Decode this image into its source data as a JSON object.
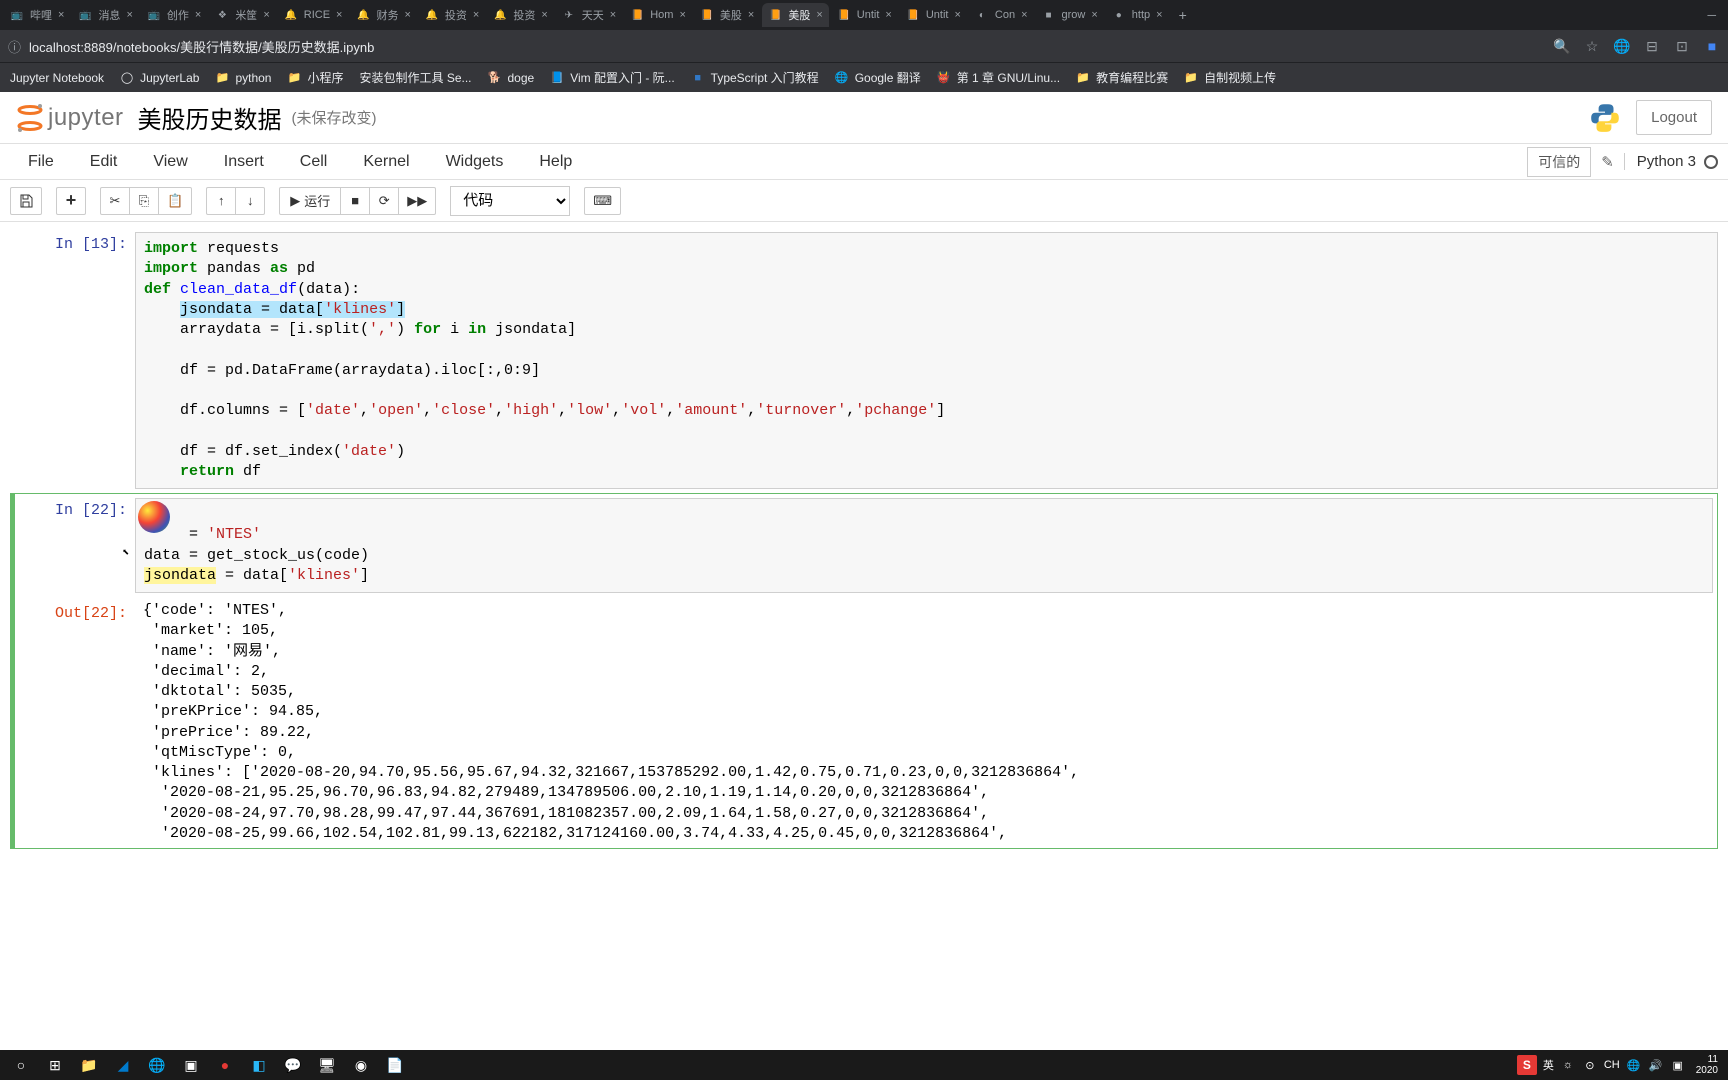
{
  "browser": {
    "tabs": [
      {
        "label": "哔哩",
        "active": false
      },
      {
        "label": "消息",
        "active": false
      },
      {
        "label": "创作",
        "active": false
      },
      {
        "label": "米筐",
        "active": false
      },
      {
        "label": "RICE",
        "active": false
      },
      {
        "label": "财务",
        "active": false
      },
      {
        "label": "投资",
        "active": false
      },
      {
        "label": "投资",
        "active": false
      },
      {
        "label": "天天",
        "active": false
      },
      {
        "label": "Hom",
        "active": false
      },
      {
        "label": "美股",
        "active": false
      },
      {
        "label": "美股",
        "active": true
      },
      {
        "label": "Untit",
        "active": false
      },
      {
        "label": "Untit",
        "active": false
      },
      {
        "label": "Con",
        "active": false
      },
      {
        "label": "grow",
        "active": false
      },
      {
        "label": "http",
        "active": false
      }
    ],
    "url": "localhost:8889/notebooks/美股行情数据/美股历史数据.ipynb",
    "bookmarks": [
      {
        "label": "Jupyter Notebook"
      },
      {
        "label": "JupyterLab"
      },
      {
        "label": "python"
      },
      {
        "label": "小程序"
      },
      {
        "label": "安装包制作工具 Se..."
      },
      {
        "label": "doge"
      },
      {
        "label": "Vim 配置入门 - 阮..."
      },
      {
        "label": "TypeScript 入门教程"
      },
      {
        "label": "Google 翻译"
      },
      {
        "label": "第 1 章 GNU/Linu..."
      },
      {
        "label": "教育编程比赛"
      },
      {
        "label": "自制视频上传"
      }
    ]
  },
  "jupyter": {
    "logo": "jupyter",
    "title": "美股历史数据",
    "unsaved": "(未保存改变)",
    "logout": "Logout",
    "menus": [
      "File",
      "Edit",
      "View",
      "Insert",
      "Cell",
      "Kernel",
      "Widgets",
      "Help"
    ],
    "trusted": "可信的",
    "kernel": "Python 3",
    "run_label": "运行",
    "cell_type": "代码"
  },
  "cells": {
    "c1_prompt": "In [13]:",
    "c2_prompt": "In [22]:",
    "c2_out_prompt": "Out[22]:",
    "code1_l1a": "import",
    "code1_l1b": " requests",
    "code1_l2a": "import",
    "code1_l2b": " pandas ",
    "code1_l2c": "as",
    "code1_l2d": " pd",
    "code1_l3a": "def",
    "code1_l3b": " ",
    "code1_l3c": "clean_data_df",
    "code1_l3d": "(data):",
    "code1_l4a": "    ",
    "code1_l4b": "jsondata = ",
    "code1_l4c": "data[",
    "code1_l4d": "'klines'",
    "code1_l4e": "]",
    "code1_l5a": "    arraydata = [i.split(",
    "code1_l5b": "','",
    "code1_l5c": ") ",
    "code1_l5d": "for",
    "code1_l5e": " i ",
    "code1_l5f": "in",
    "code1_l5g": " jsondata]",
    "code1_l6": "",
    "code1_l7": "    df = pd.DataFrame(arraydata).iloc[:,0:9]",
    "code1_l8": "",
    "code1_l9a": "    df.columns = [",
    "code1_l9b": "'date'",
    "code1_l9c": ",",
    "code1_l9d": "'open'",
    "code1_l9e": ",",
    "code1_l9f": "'close'",
    "code1_l9g": ",",
    "code1_l9h": "'high'",
    "code1_l9i": ",",
    "code1_l9j": "'low'",
    "code1_l9k": ",",
    "code1_l9l": "'vol'",
    "code1_l9m": ",",
    "code1_l9n": "'amount'",
    "code1_l9o": ",",
    "code1_l9p": "'turnover'",
    "code1_l9q": ",",
    "code1_l9r": "'pchange'",
    "code1_l9s": "]",
    "code1_l10": "",
    "code1_l11a": "    df = df.set_index(",
    "code1_l11b": "'date'",
    "code1_l11c": ")",
    "code1_l12a": "    ",
    "code1_l12b": "return",
    "code1_l12c": " df",
    "code2_l1a": "     = ",
    "code2_l1b": "'NTES'",
    "code2_l2": "data = get_stock_us(code)",
    "code2_l3a": "jsondata",
    "code2_l3b": " = data[",
    "code2_l3c": "'klines'",
    "code2_l3d": "]",
    "out_l1": "{'code': 'NTES',",
    "out_l2": " 'market': 105,",
    "out_l3": " 'name': '网易',",
    "out_l4": " 'decimal': 2,",
    "out_l5": " 'dktotal': 5035,",
    "out_l6": " 'preKPrice': 94.85,",
    "out_l7": " 'prePrice': 89.22,",
    "out_l8": " 'qtMiscType': 0,",
    "out_l9": " 'klines': ['2020-08-20,94.70,95.56,95.67,94.32,321667,153785292.00,1.42,0.75,0.71,0.23,0,0,3212836864',",
    "out_l10": "  '2020-08-21,95.25,96.70,96.83,94.82,279489,134789506.00,2.10,1.19,1.14,0.20,0,0,3212836864',",
    "out_l11": "  '2020-08-24,97.70,98.28,99.47,97.44,367691,181082357.00,2.09,1.64,1.58,0.27,0,0,3212836864',",
    "out_l12": "  '2020-08-25,99.66,102.54,102.81,99.13,622182,317124160.00,3.74,4.33,4.25,0.45,0,0,3212836864',"
  },
  "taskbar": {
    "ime_lang": "英",
    "ime_ch": "CH",
    "clock_time": "11",
    "clock_date": "2020"
  }
}
